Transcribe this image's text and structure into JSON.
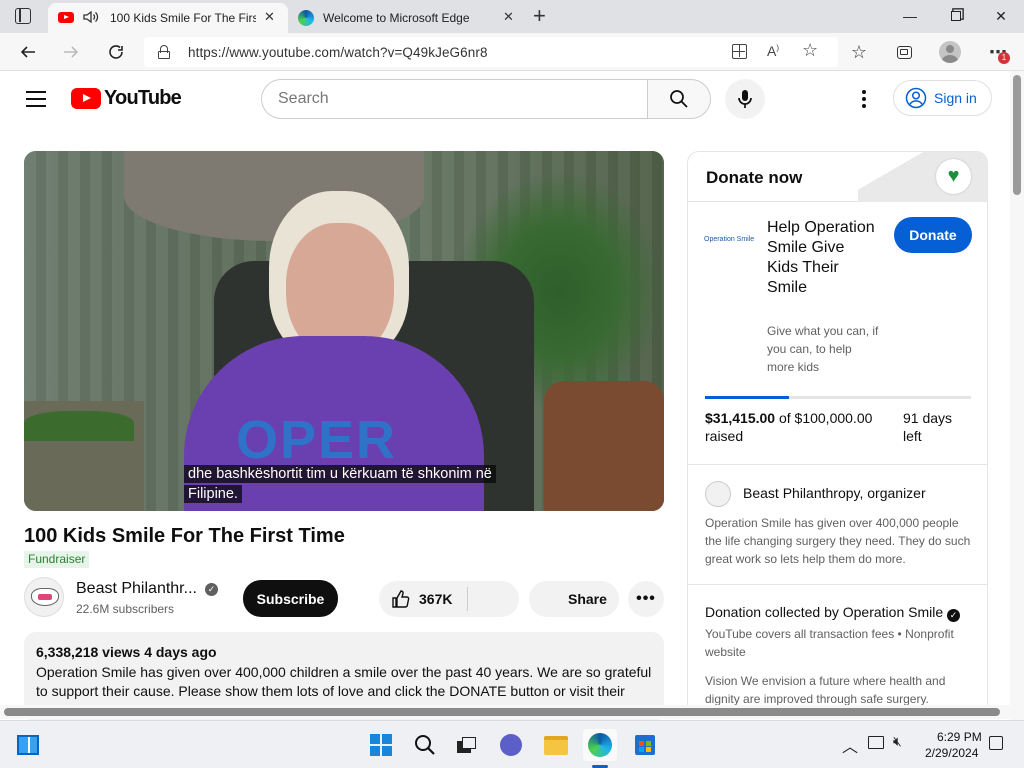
{
  "browser": {
    "tabs": [
      {
        "title": "100 Kids Smile For The First Time",
        "active": true
      },
      {
        "title": "Welcome to Microsoft Edge",
        "active": false
      }
    ],
    "url": "https://www.youtube.com/watch?v=Q49kJeG6nr8",
    "notification_badge": "1"
  },
  "youtube": {
    "logo_text": "YouTube",
    "search_placeholder": "Search",
    "signin_label": "Sign in"
  },
  "video": {
    "caption_line1": "dhe bashkëshortit tim u kërkuam të shkonim në",
    "caption_line2": "Filipine.",
    "shirt_text": "OPER",
    "title": "100 Kids Smile For The First Time",
    "badge": "Fundraiser",
    "channel_name": "Beast Philanthr...",
    "channel_subs": "22.6M subscribers",
    "subscribe_label": "Subscribe",
    "like_count": "367K",
    "share_label": "Share",
    "views_date": "6,338,218 views  4 days ago",
    "description": "Operation Smile has given over 400,000 children a smile over the past 40 years. We are so grateful to support their cause. Please show them lots of love and click the DONATE button or visit their"
  },
  "donate": {
    "header": "Donate now",
    "org_logo_text": "Operation Smile",
    "campaign_title": "Help Operation Smile Give Kids Their Smile",
    "campaign_sub": "Give what you can, if you can, to help more kids",
    "donate_label": "Donate",
    "raised_amount": "$31,415.00",
    "raised_rest": " of $100,000.00 raised",
    "progress_fraction": 0.314,
    "days_left": "91 days left",
    "organizer_name": "Beast Philanthropy",
    "organizer_suffix": ", organizer",
    "organizer_desc": "Operation Smile has given over 400,000 people the life changing surgery they need. They do such great work so lets help them do more.",
    "collected_by": "Donation collected by Operation Smile",
    "fees_text": "YouTube covers all transaction fees  •  Nonprofit website",
    "vision_text": "Vision We envision a future where health and dignity are improved through safe surgery."
  },
  "taskbar": {
    "time": "6:29 PM",
    "date": "2/29/2024"
  },
  "colors": {
    "youtube_red": "#ff0000",
    "link_blue": "#065fd4",
    "fundraiser_green": "#2e7d32"
  }
}
